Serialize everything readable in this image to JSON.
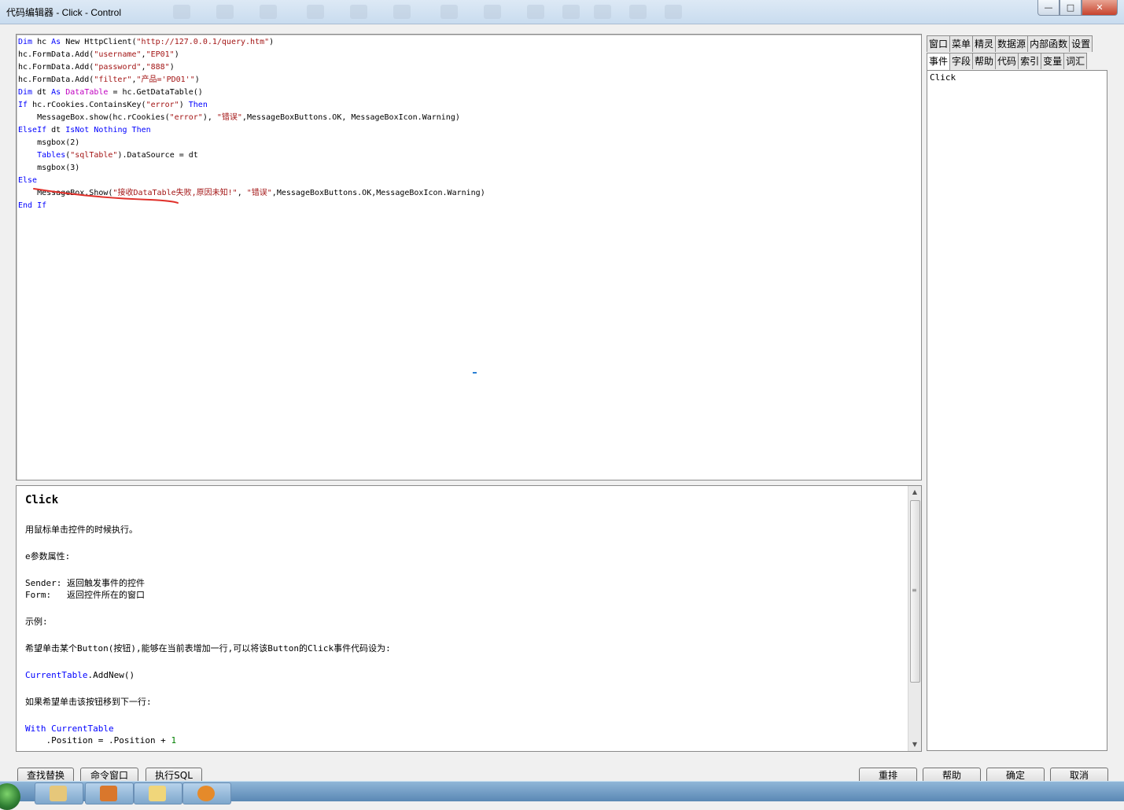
{
  "window": {
    "title": "代码编辑器 - Click - Control",
    "buttons": {
      "minimize": "—",
      "maximize": "□",
      "close": "✕"
    }
  },
  "editor": {
    "lines": [
      [
        {
          "t": "Dim",
          "c": "kw"
        },
        {
          "t": " hc "
        },
        {
          "t": "As",
          "c": "kw"
        },
        {
          "t": " New HttpClient("
        },
        {
          "t": "\"http://127.0.0.1/query.htm\"",
          "c": "str"
        },
        {
          "t": ")"
        }
      ],
      [
        {
          "t": "hc.FormData.Add("
        },
        {
          "t": "\"username\"",
          "c": "str"
        },
        {
          "t": ","
        },
        {
          "t": "\"EP01\"",
          "c": "str"
        },
        {
          "t": ")"
        }
      ],
      [
        {
          "t": "hc.FormData.Add("
        },
        {
          "t": "\"password\"",
          "c": "str"
        },
        {
          "t": ","
        },
        {
          "t": "\"888\"",
          "c": "str"
        },
        {
          "t": ")"
        }
      ],
      [
        {
          "t": "hc.FormData.Add("
        },
        {
          "t": "\"filter\"",
          "c": "str"
        },
        {
          "t": ","
        },
        {
          "t": "\"产品='PD01'\"",
          "c": "str"
        },
        {
          "t": ")"
        }
      ],
      [
        {
          "t": "Dim",
          "c": "kw"
        },
        {
          "t": " dt "
        },
        {
          "t": "As",
          "c": "kw"
        },
        {
          "t": " "
        },
        {
          "t": "DataTable",
          "c": "typ"
        },
        {
          "t": " = hc.GetDataTable()"
        }
      ],
      [
        {
          "t": "If",
          "c": "kw"
        },
        {
          "t": " hc.rCookies.ContainsKey("
        },
        {
          "t": "\"error\"",
          "c": "str"
        },
        {
          "t": ") "
        },
        {
          "t": "Then",
          "c": "kw"
        }
      ],
      [
        {
          "t": "    MessageBox.show(hc.rCookies("
        },
        {
          "t": "\"error\"",
          "c": "str"
        },
        {
          "t": "), "
        },
        {
          "t": "\"错误\"",
          "c": "str"
        },
        {
          "t": ",MessageBoxButtons.OK, MessageBoxIcon.Warning)"
        }
      ],
      [
        {
          "t": "ElseIf",
          "c": "kw"
        },
        {
          "t": " dt "
        },
        {
          "t": "IsNot",
          "c": "kw"
        },
        {
          "t": " "
        },
        {
          "t": "Nothing",
          "c": "kw"
        },
        {
          "t": " "
        },
        {
          "t": "Then",
          "c": "kw"
        }
      ],
      [
        {
          "t": "    msgbox(2)"
        }
      ],
      [
        {
          "t": "    "
        },
        {
          "t": "Tables",
          "c": "kw"
        },
        {
          "t": "("
        },
        {
          "t": "\"sqlTable\"",
          "c": "str"
        },
        {
          "t": ").DataSource = dt"
        }
      ],
      [
        {
          "t": "    msgbox(3)"
        }
      ],
      [
        {
          "t": "Else",
          "c": "kw"
        }
      ],
      [
        {
          "t": "    MessageBox.Show("
        },
        {
          "t": "\"接收DataTable失败,原因未知!\"",
          "c": "str"
        },
        {
          "t": ", "
        },
        {
          "t": "\"错误\"",
          "c": "str"
        },
        {
          "t": ",MessageBoxButtons.OK,MessageBoxIcon.Warning)"
        }
      ],
      [
        {
          "t": "End If",
          "c": "kw"
        }
      ]
    ]
  },
  "help": {
    "title": "Click",
    "lines": [
      {
        "t": "用鼠标单击控件的时候执行。"
      },
      {
        "gap": true
      },
      {
        "t": "e参数属性:"
      },
      {
        "gap": true
      },
      {
        "t": "Sender: 返回触发事件的控件"
      },
      {
        "t": "Form:   返回控件所在的窗口"
      },
      {
        "gap": true
      },
      {
        "t": "示例:"
      },
      {
        "gap": true
      },
      {
        "t": "希望单击某个Button(按钮),能够在当前表增加一行,可以将该Button的Click事件代码设为:"
      },
      {
        "gap": true
      },
      {
        "parts": [
          {
            "t": "CurrentTable",
            "c": "blue"
          },
          {
            "t": ".AddNew()"
          }
        ]
      },
      {
        "gap": true
      },
      {
        "t": "如果希望单击该按钮移到下一行:"
      },
      {
        "gap": true
      },
      {
        "parts": [
          {
            "t": "With",
            "c": "blue"
          },
          {
            "t": " "
          },
          {
            "t": "CurrentTable",
            "c": "blue"
          }
        ]
      },
      {
        "parts": [
          {
            "t": "    .Position = .Position + "
          },
          {
            "t": "1",
            "c": "grn"
          }
        ]
      }
    ]
  },
  "right_tabs": {
    "row1": [
      "窗口",
      "菜单",
      "精灵",
      "数据源",
      "内部函数",
      "设置"
    ],
    "row2": [
      "事件",
      "字段",
      "帮助",
      "代码",
      "索引",
      "变量",
      "词汇"
    ],
    "active": "事件"
  },
  "event_list": [
    "Click"
  ],
  "buttons_left": [
    "查找替换",
    "命令窗口",
    "执行SQL"
  ],
  "buttons_right": [
    "重排",
    "帮助",
    "确定",
    "取消"
  ],
  "colors": {
    "keyword": "#0000ff",
    "string": "#a31515",
    "type": "#c000c0",
    "annotation": "#e0302a"
  }
}
